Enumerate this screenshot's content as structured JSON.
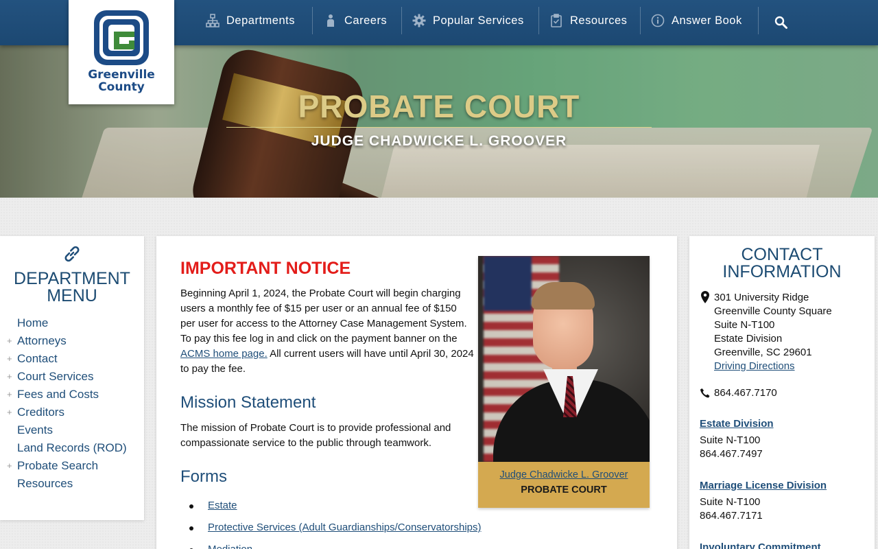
{
  "nav": {
    "items": [
      {
        "label": "Departments",
        "icon": "org-chart-icon"
      },
      {
        "label": "Careers",
        "icon": "people-icon"
      },
      {
        "label": "Popular Services",
        "icon": "gear-icon"
      },
      {
        "label": "Resources",
        "icon": "clipboard-icon"
      },
      {
        "label": "Answer Book",
        "icon": "info-icon"
      }
    ],
    "search_icon": "search-icon"
  },
  "logo": {
    "line1": "Greenville",
    "line2": "County"
  },
  "hero": {
    "title": "PROBATE COURT",
    "subtitle": "JUDGE CHADWICKE L. GROOVER"
  },
  "dept_menu": {
    "title_line1": "DEPARTMENT",
    "title_line2": "MENU",
    "items": [
      {
        "label": "Home",
        "expandable": false
      },
      {
        "label": "Attorneys",
        "expandable": true
      },
      {
        "label": "Contact",
        "expandable": true
      },
      {
        "label": "Court Services",
        "expandable": true
      },
      {
        "label": "Fees and Costs",
        "expandable": true
      },
      {
        "label": "Creditors",
        "expandable": true
      },
      {
        "label": "Events",
        "expandable": false
      },
      {
        "label": "Land Records (ROD)",
        "expandable": false
      },
      {
        "label": "Probate Search",
        "expandable": true
      },
      {
        "label": "Resources",
        "expandable": false
      }
    ]
  },
  "main": {
    "notice_title": "IMPORTANT NOTICE",
    "notice_before": "Beginning April 1, 2024, the Probate Court will begin charging users a monthly fee of $15 per user or an annual fee of $150 per user for access to the Attorney Case Management System. To pay this fee log in and click on the payment banner on the ",
    "notice_link": "ACMS home page.",
    "notice_after": " All current users will have until April 30, 2024 to pay the fee.",
    "mission_title": "Mission Statement",
    "mission_body": "The mission of Probate Court is to provide professional and compassionate service to the public through teamwork.",
    "forms_title": "Forms",
    "forms": [
      "Estate",
      "Protective Services (Adult Guardianships/Conservatorships)",
      "Mediation"
    ],
    "judge_name": "Judge Chadwicke L. Groover",
    "judge_court": "PROBATE COURT"
  },
  "contact": {
    "title_line1": "CONTACT",
    "title_line2": "INFORMATION",
    "address": [
      "301 University Ridge",
      "Greenville County Square",
      "Suite N-T100",
      "Estate Division",
      "Greenville, SC 29601"
    ],
    "directions": "Driving Directions",
    "phone": "864.467.7170",
    "divisions": [
      {
        "name": "Estate Division",
        "suite": "Suite N-T100",
        "phone": "864.467.7497"
      },
      {
        "name": "Marriage License Division",
        "suite": "Suite N-T100",
        "phone": "864.467.7171"
      },
      {
        "name": "Involuntary Commitment",
        "suite": "",
        "phone": ""
      }
    ]
  },
  "colors": {
    "nav_bg": "#1f4e79",
    "notice_red": "#e31d1a",
    "heading_blue": "#1f4e79",
    "hero_title_gold": "#dccb87",
    "caption_gold": "#d4a950"
  }
}
